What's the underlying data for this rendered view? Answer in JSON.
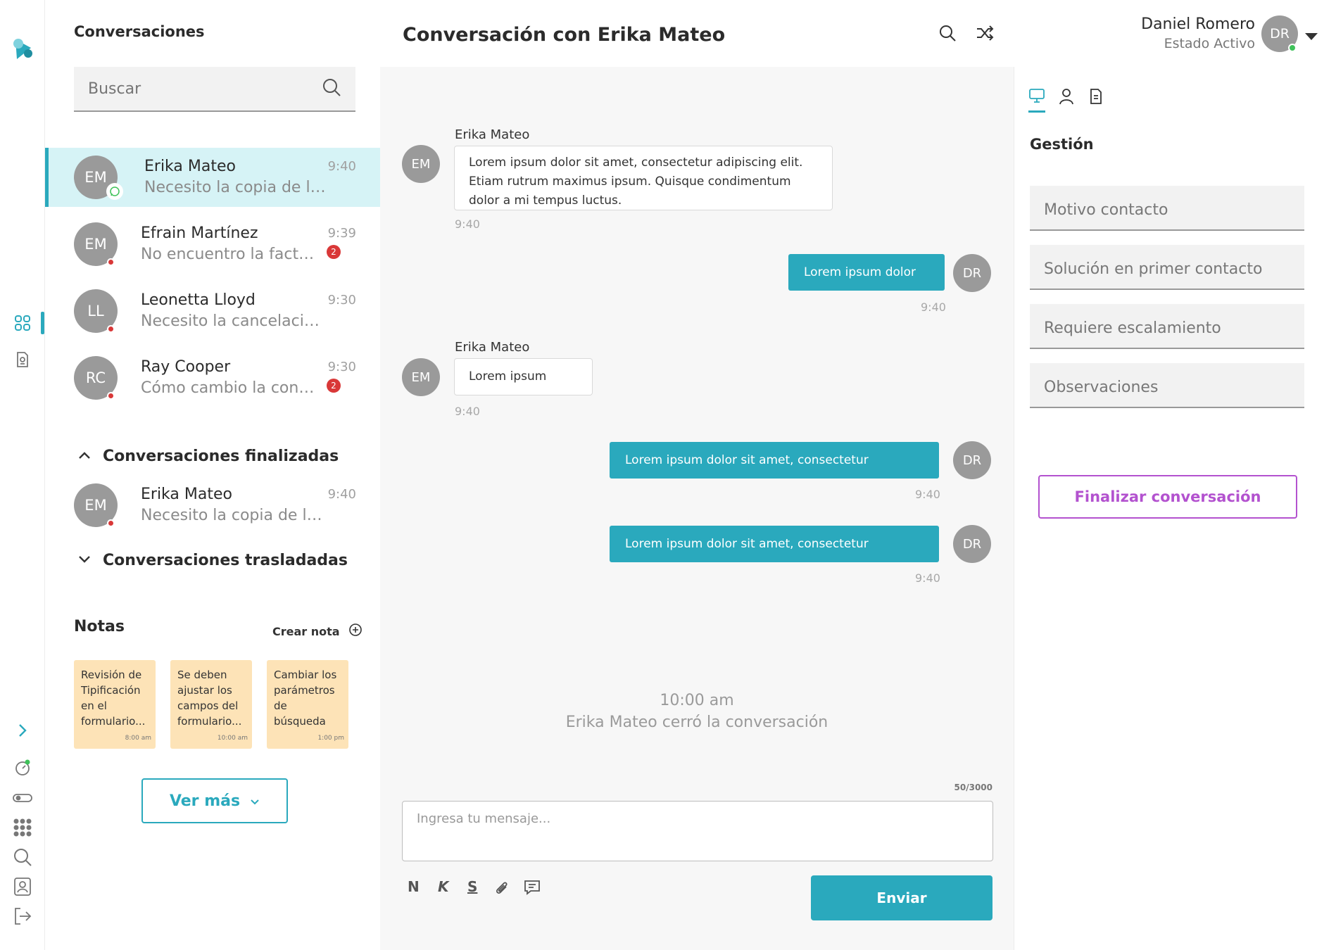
{
  "app": {
    "logo": "app-logo"
  },
  "rail": {
    "items": [
      {
        "name": "dashboard-icon"
      },
      {
        "name": "document-icon"
      },
      {
        "name": "expand-icon"
      },
      {
        "name": "timer-icon"
      },
      {
        "name": "toggle-icon"
      },
      {
        "name": "grid-icon"
      },
      {
        "name": "search-icon"
      },
      {
        "name": "contacts-icon"
      },
      {
        "name": "logout-icon"
      }
    ]
  },
  "list": {
    "title": "Conversaciones",
    "search_placeholder": "Buscar",
    "conversations": [
      {
        "initials": "EM",
        "name": "Erika Mateo",
        "preview": "Necesito la copia de la...",
        "time": "9:40",
        "channel": "whatsapp-icon"
      },
      {
        "initials": "EM",
        "name": "Efrain Martínez",
        "preview": "No encuentro la factura...",
        "time": "9:39",
        "badge": "2"
      },
      {
        "initials": "LL",
        "name": "Leonetta Lloyd",
        "preview": "Necesito la cancelación...",
        "time": "9:30"
      },
      {
        "initials": "RC",
        "name": "Ray Cooper",
        "preview": "Cómo cambio la cont...",
        "time": "9:30",
        "badge": "2"
      }
    ],
    "finished": {
      "title": "Conversaciones finalizadas",
      "items": [
        {
          "initials": "EM",
          "name": "Erika Mateo",
          "preview": "Necesito la copia de la...",
          "time": "9:40"
        }
      ]
    },
    "transferred": {
      "title": "Conversaciones trasladadas"
    },
    "notes": {
      "title": "Notas",
      "create_label": "Crear nota",
      "items": [
        {
          "text": "Revisión de Tipificación en el formulario...",
          "time": "8:00 am"
        },
        {
          "text": "Se deben ajustar los campos del formulario...",
          "time": "10:00 am"
        },
        {
          "text": "Cambiar los parámetros de búsqueda de los cam...",
          "time": "1:00 pm"
        }
      ],
      "more_label": "Ver más"
    }
  },
  "chat": {
    "title": "Conversación con Erika Mateo",
    "messages": [
      {
        "from": "Erika Mateo",
        "initials": "EM",
        "text": "Lorem ipsum dolor sit amet, consectetur adipiscing elit. Etiam rutrum maximus ipsum. Quisque condimentum dolor a mi tempus luctus.",
        "time": "9:40"
      },
      {
        "initials": "DR",
        "text": "Lorem ipsum dolor",
        "time": "9:40"
      },
      {
        "from": "Erika Mateo",
        "initials": "EM",
        "text": "Lorem ipsum",
        "time": "9:40"
      },
      {
        "initials": "DR",
        "text": "Lorem ipsum dolor sit amet, consectetur",
        "time": "9:40"
      },
      {
        "initials": "DR",
        "text": "Lorem ipsum dolor sit amet, consectetur",
        "time": "9:40"
      }
    ],
    "closed_time": "10:00 am",
    "closed_text": "Erika Mateo cerró la conversación",
    "char_count": "50/3000",
    "input_placeholder": "Ingresa tu mensaje...",
    "tools": {
      "bold": "N",
      "italic": "K",
      "strike": "S"
    },
    "send_label": "Enviar"
  },
  "user": {
    "name": "Daniel Romero",
    "status": "Estado Activo",
    "initials": "DR"
  },
  "panel": {
    "title": "Gestión",
    "fields": [
      "Motivo contacto",
      "Solución en primer contacto",
      "Requiere escalamiento",
      "Observaciones"
    ],
    "finish_label": "Finalizar conversación"
  },
  "colors": {
    "accent": "#2aa9bd",
    "danger": "#d93838",
    "purple": "#b352cf",
    "note": "#fde3b7"
  }
}
